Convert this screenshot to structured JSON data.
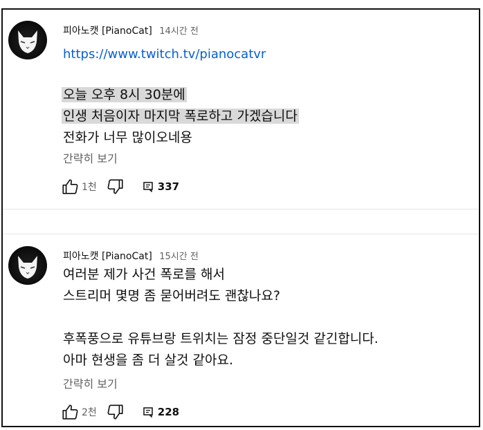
{
  "comments": [
    {
      "author": "피아노캣 [PianoCat]",
      "time": "14시간 전",
      "link": "https://www.twitch.tv/pianocatvr",
      "lines_highlighted": [
        "오늘 오후 8시 30분에",
        "인생 처음이자 마지막 폭로하고 가겠습니다"
      ],
      "lines": [
        "전화가 너무 많이오네용"
      ],
      "show_less": "간략히 보기",
      "likes": "1천",
      "replies": "337"
    },
    {
      "author": "피아노캣 [PianoCat]",
      "time": "15시간 전",
      "lines": [
        "여러분 제가 사건 폭로를 해서",
        "스트리머 몇명 좀 묻어버려도 괜찮나요?",
        "",
        "후폭풍으로 유튜브랑 트위치는 잠정 중단일것 같긴합니다.",
        "아마 현생을 좀 더 살것 같아요."
      ],
      "show_less": "간략히 보기",
      "likes": "2천",
      "replies": "228"
    }
  ],
  "icons": {
    "avatar": "white-cat-mask-avatar",
    "like": "thumbs-up-icon",
    "dislike": "thumbs-down-icon",
    "reply": "comment-icon"
  },
  "colors": {
    "link": "#065fd4",
    "highlight": "#d9d9d9",
    "muted": "#606060"
  }
}
